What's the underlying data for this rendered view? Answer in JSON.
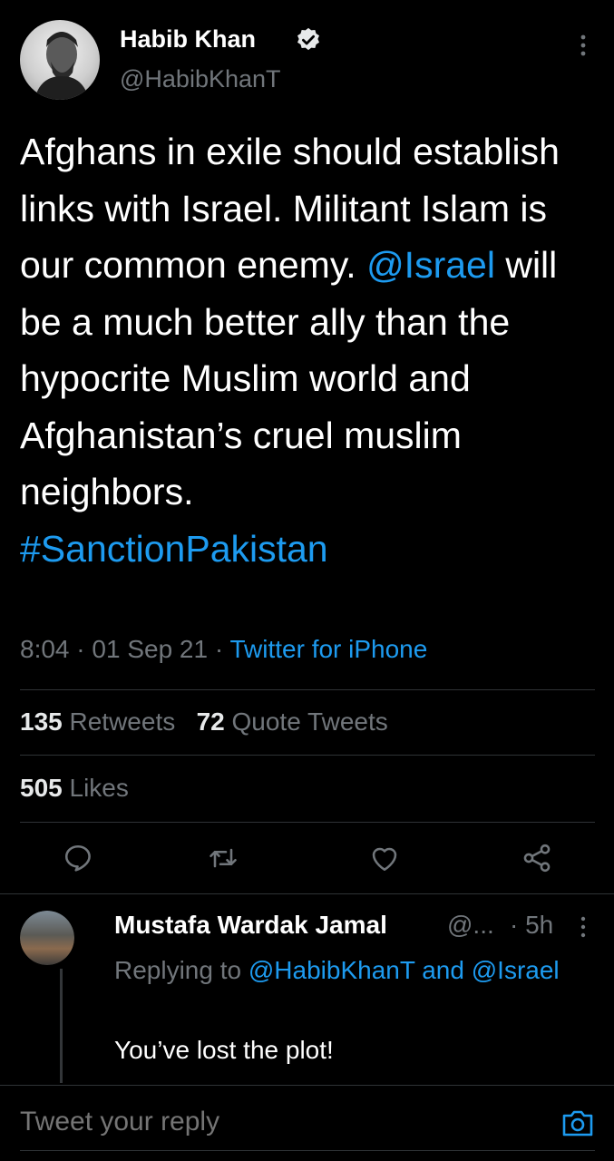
{
  "tweet": {
    "author_name": "Habib Khan",
    "author_handle": "@HabibKhanT",
    "text_parts": [
      "Afghans in exile should establish links with Israel. Militant Islam is our common enemy. ",
      "@Israel",
      " will be a much better ally than the hypocrite Muslim world and Afghanistan’s cruel muslim neighbors."
    ],
    "hashtag": "#SanctionPakistan",
    "time": "8:04",
    "sep1": " · ",
    "date": "01 Sep 21",
    "sep2": " · ",
    "source": "Twitter for iPhone",
    "retweets_count": "135",
    "retweets_label": "Retweets",
    "quotes_count": "72",
    "quotes_label": "Quote Tweets",
    "likes_count": "505",
    "likes_label": "Likes"
  },
  "icons": {
    "verified": "verified-badge-icon",
    "more": "more-vertical-icon",
    "reply": "reply-icon",
    "retweet": "retweet-icon",
    "like": "heart-icon",
    "share": "share-icon",
    "camera": "camera-icon"
  },
  "reply": {
    "author_name": "Mustafa Wardak Jamal",
    "author_handle": "@...",
    "time": "· 5h",
    "context_prefix": "Replying to ",
    "mention1": "@HabibKhanT",
    "and": " and ",
    "mention2": "@Israel",
    "text": "You’ve lost the plot!"
  },
  "composer": {
    "placeholder": "Tweet your reply"
  },
  "colors": {
    "background": "#000000",
    "text": "#ffffff",
    "muted": "#71767b",
    "link": "#1d9bf0",
    "divider": "#2f3336"
  }
}
